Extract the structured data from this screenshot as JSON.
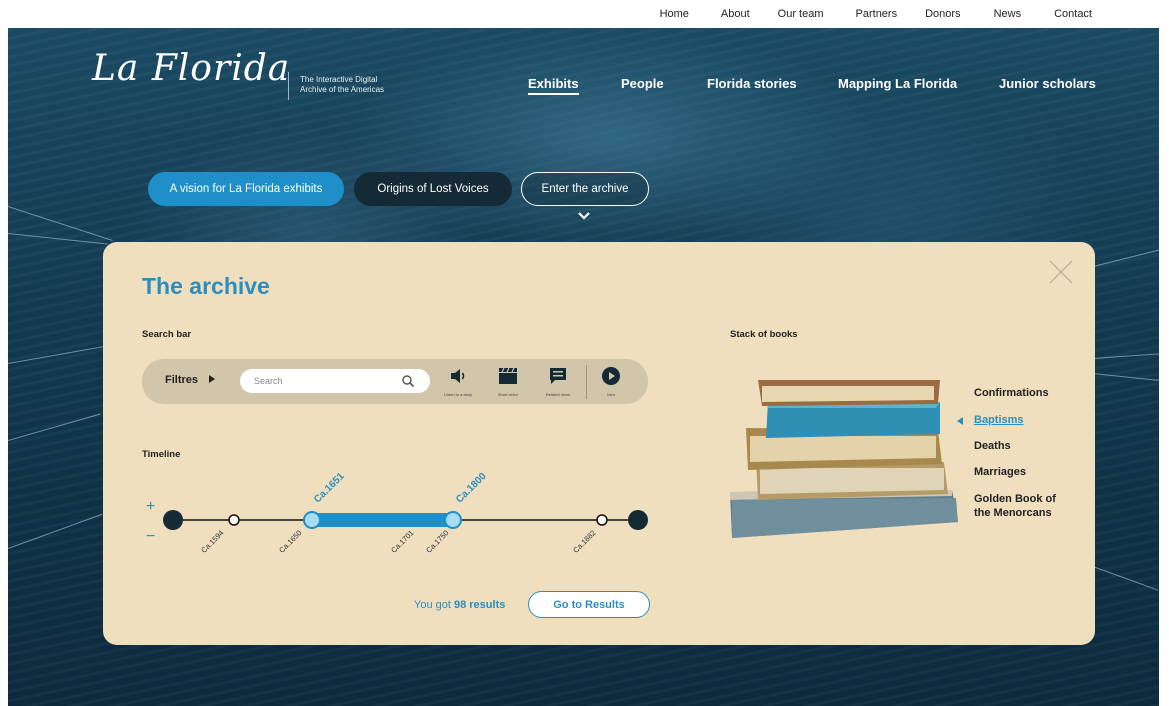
{
  "top_nav": [
    "Home",
    "About",
    "Our team",
    "Partners",
    "Donors",
    "News",
    "Contact"
  ],
  "logo": {
    "text": "La Florida",
    "tagline_line1": "The Interactive Digital",
    "tagline_line2": "Archive of the Americas"
  },
  "main_nav": [
    {
      "label": "Exhibits",
      "active": true
    },
    {
      "label": "People",
      "active": false
    },
    {
      "label": "Florida stories",
      "active": false
    },
    {
      "label": "Mapping La Florida",
      "active": false
    },
    {
      "label": "Junior scholars",
      "active": false
    }
  ],
  "exhibit_tabs": [
    {
      "label": "A vision for La Florida exhibits",
      "style": "primary"
    },
    {
      "label": "Origins of Lost Voices",
      "style": "dark"
    },
    {
      "label": "Enter the archive",
      "style": "outline"
    }
  ],
  "archive": {
    "title": "The archive",
    "search_section_label": "Search bar",
    "filters_label": "Filtres",
    "search_placeholder": "Search",
    "tools": [
      {
        "icon": "speaker-icon",
        "caption": "Listen to a story"
      },
      {
        "icon": "clapperboard-icon",
        "caption": "Short video"
      },
      {
        "icon": "comment-icon",
        "caption": "Related news"
      },
      {
        "icon": "play-icon",
        "caption": "Intro"
      }
    ],
    "timeline_label": "Timeline",
    "timeline": {
      "zoom_in": "+",
      "zoom_out": "−",
      "selected_start": "Ca.1651",
      "selected_end": "Ca.1800",
      "ticks": [
        "Ca.1594",
        "Ca.1650",
        "Ca.1701",
        "Ca.1750",
        "Ca.1882"
      ]
    },
    "results_prefix": "You got",
    "results_count": "98 results",
    "go_button": "Go to Results",
    "stack_label": "Stack of books",
    "books": [
      {
        "label": "Confirmations",
        "selected": false
      },
      {
        "label": "Baptisms",
        "selected": true
      },
      {
        "label": "Deaths",
        "selected": false
      },
      {
        "label": "Marriages",
        "selected": false
      },
      {
        "label": "Golden Book of",
        "selected": false
      },
      {
        "label": "the Menorcans",
        "selected": false
      }
    ]
  },
  "colors": {
    "accent": "#2a8fbf",
    "panel": "#efdfbf",
    "dark": "#142b36"
  }
}
